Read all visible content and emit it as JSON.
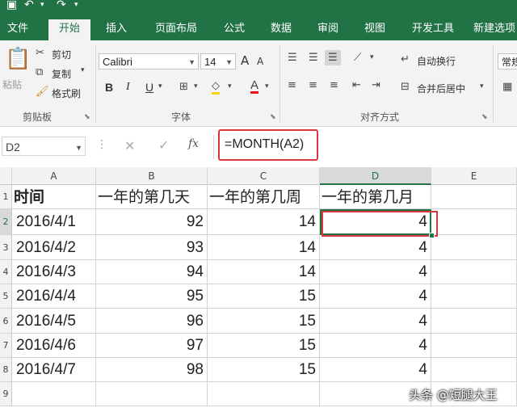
{
  "app": {
    "accent": "#217346"
  },
  "tabs": [
    {
      "label": "文件"
    },
    {
      "label": "开始"
    },
    {
      "label": "插入"
    },
    {
      "label": "页面布局"
    },
    {
      "label": "公式"
    },
    {
      "label": "数据"
    },
    {
      "label": "审阅"
    },
    {
      "label": "视图"
    },
    {
      "label": "开发工具"
    },
    {
      "label": "新建选项"
    }
  ],
  "ribbon": {
    "clipboard": {
      "paste": "粘贴",
      "cut": "剪切",
      "copy": "复制",
      "format_painter": "格式刷",
      "group": "剪贴板"
    },
    "font": {
      "name": "Calibri",
      "size": "14",
      "bold": "B",
      "italic": "I",
      "underline": "U",
      "grow": "A",
      "shrink": "A",
      "group": "字体"
    },
    "alignment": {
      "wrap": "自动换行",
      "merge": "合并后居中",
      "group": "对齐方式"
    },
    "number": {
      "format": "常规"
    }
  },
  "formula_bar": {
    "name_box": "D2",
    "fx": "fx",
    "formula": "=MONTH(A2)",
    "highlight_color": "#d9373b"
  },
  "grid": {
    "columns": [
      "A",
      "B",
      "C",
      "D",
      "E"
    ],
    "selected_column": "D",
    "rows": [
      "1",
      "2",
      "3",
      "4",
      "5",
      "6",
      "7",
      "8",
      "9"
    ],
    "selected_row": "2",
    "headers": [
      "时间",
      "一年的第几天",
      "一年的第几周",
      "一年的第几月"
    ],
    "data": [
      [
        "2016/4/1",
        "92",
        "14",
        "4"
      ],
      [
        "2016/4/2",
        "93",
        "14",
        "4"
      ],
      [
        "2016/4/3",
        "94",
        "14",
        "4"
      ],
      [
        "2016/4/4",
        "95",
        "15",
        "4"
      ],
      [
        "2016/4/5",
        "96",
        "15",
        "4"
      ],
      [
        "2016/4/6",
        "97",
        "15",
        "4"
      ],
      [
        "2016/4/7",
        "98",
        "15",
        "4"
      ]
    ],
    "active_cell": "D2"
  },
  "watermark": "头条 @短腿大王"
}
